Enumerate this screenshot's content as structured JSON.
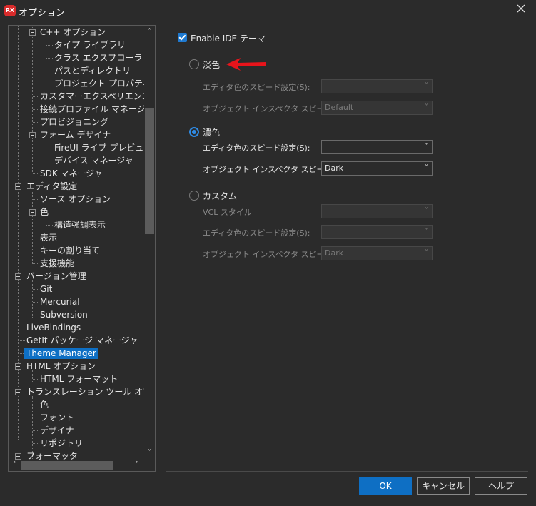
{
  "window": {
    "title": "オプション",
    "app_icon_text": "RX"
  },
  "tree": {
    "items": [
      {
        "label": "C++ オプション"
      },
      {
        "label": "タイプ ライブラリ"
      },
      {
        "label": "クラス エクスプローラ"
      },
      {
        "label": "パスとディレクトリ"
      },
      {
        "label": "プロジェクト プロパティ"
      },
      {
        "label": "カスタマーエクスペリエンス プログラム"
      },
      {
        "label": "接続プロファイル マネージャ"
      },
      {
        "label": "プロビジョニング"
      },
      {
        "label": "フォーム デザイナ"
      },
      {
        "label": "FireUI ライブ プレビュー"
      },
      {
        "label": "デバイス マネージャ"
      },
      {
        "label": "SDK マネージャ"
      },
      {
        "label": "エディタ設定"
      },
      {
        "label": "ソース オプション"
      },
      {
        "label": "色"
      },
      {
        "label": "構造強調表示"
      },
      {
        "label": "表示"
      },
      {
        "label": "キーの割り当て"
      },
      {
        "label": "支援機能"
      },
      {
        "label": "バージョン管理"
      },
      {
        "label": "Git"
      },
      {
        "label": "Mercurial"
      },
      {
        "label": "Subversion"
      },
      {
        "label": "LiveBindings"
      },
      {
        "label": "GetIt パッケージ マネージャ"
      },
      {
        "label": "Theme Manager"
      },
      {
        "label": "HTML オプション"
      },
      {
        "label": "HTML フォーマット"
      },
      {
        "label": "トランスレーション ツール オプション"
      },
      {
        "label": "色"
      },
      {
        "label": "フォント"
      },
      {
        "label": "デザイナ"
      },
      {
        "label": "リポジトリ"
      },
      {
        "label": "フォーマッタ"
      }
    ],
    "selected": "Theme Manager"
  },
  "settings": {
    "enable_label": "Enable IDE テーマ",
    "light": {
      "label": "淡色",
      "editor_speed_label": "エディタ色のスピード設定(S):",
      "editor_speed_value": "",
      "inspector_label": "オブジェクト インスペクタ スピード設定",
      "inspector_value": "Default"
    },
    "dark": {
      "label": "濃色",
      "editor_speed_label": "エディタ色のスピード設定(S):",
      "editor_speed_value": "",
      "inspector_label": "オブジェクト インスペクタ スピード設定",
      "inspector_value": "Dark"
    },
    "custom": {
      "label": "カスタム",
      "vcl_label": "VCL スタイル",
      "vcl_value": "",
      "editor_speed_label": "エディタ色のスピード設定(S):",
      "editor_speed_value": "",
      "inspector_label": "オブジェクト インスペクタ スピード設定",
      "inspector_value": "Dark"
    }
  },
  "buttons": {
    "ok": "OK",
    "cancel": "キャンセル",
    "help": "ヘルプ"
  },
  "colors": {
    "accent": "#0e6fc4",
    "arrow": "#e8141b",
    "background": "#2b2b2b"
  }
}
